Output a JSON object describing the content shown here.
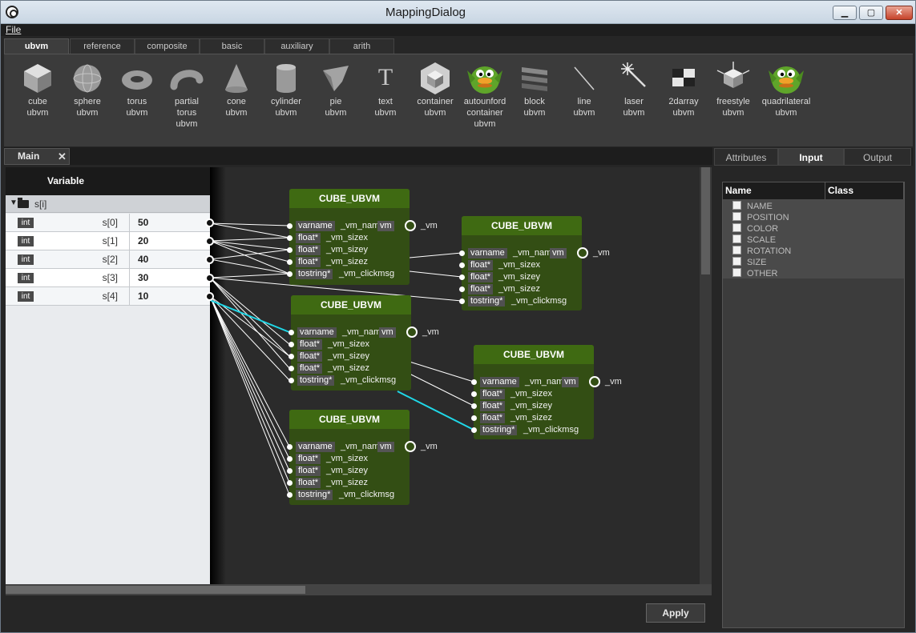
{
  "window": {
    "title": "MappingDialog"
  },
  "menu": {
    "file": "File"
  },
  "category_tabs": [
    "ubvm",
    "reference",
    "composite",
    "basic",
    "auxiliary",
    "arith"
  ],
  "palette": [
    {
      "label": "cube\nubvm",
      "icon": "cube-icon"
    },
    {
      "label": "sphere\nubvm",
      "icon": "sphere-icon"
    },
    {
      "label": "torus\nubvm",
      "icon": "torus-icon"
    },
    {
      "label": "partial\ntorus\nubvm",
      "icon": "partial-torus-icon"
    },
    {
      "label": "cone\nubvm",
      "icon": "cone-icon"
    },
    {
      "label": "cylinder\nubvm",
      "icon": "cylinder-icon"
    },
    {
      "label": "pie\nubvm",
      "icon": "pie-icon"
    },
    {
      "label": "text\nubvm",
      "icon": "text-icon"
    },
    {
      "label": "container\nubvm",
      "icon": "container-icon"
    },
    {
      "label": "autounford\ncontainer\nubvm",
      "icon": "duck-mascot-icon"
    },
    {
      "label": "block\nubvm",
      "icon": "block-icon"
    },
    {
      "label": "line\nubvm",
      "icon": "line-icon"
    },
    {
      "label": "laser\nubvm",
      "icon": "laser-icon"
    },
    {
      "label": "2darray\nubvm",
      "icon": "grid-2darray-icon"
    },
    {
      "label": "freestyle\nubvm",
      "icon": "freestyle-icon"
    },
    {
      "label": "quadrilateral\nubvm",
      "icon": "duck-mascot-icon"
    }
  ],
  "main_tab": {
    "label": "Main",
    "close": "✕"
  },
  "variables": {
    "header": "Variable",
    "group": "s[i]",
    "rows": [
      {
        "type": "int",
        "name": "s[0]",
        "value": "50"
      },
      {
        "type": "int",
        "name": "s[1]",
        "value": "20"
      },
      {
        "type": "int",
        "name": "s[2]",
        "value": "40"
      },
      {
        "type": "int",
        "name": "s[3]",
        "value": "30"
      },
      {
        "type": "int",
        "name": "s[4]",
        "value": "10"
      }
    ]
  },
  "node_common": {
    "title": "CUBE_UBVM",
    "vm_tag": "vm",
    "output_label": "_vm",
    "ports": [
      {
        "type": "varname",
        "name": "_vm_nam"
      },
      {
        "type": "float*",
        "name": "_vm_sizex"
      },
      {
        "type": "float*",
        "name": "_vm_sizey"
      },
      {
        "type": "float*",
        "name": "_vm_sizez"
      },
      {
        "type": "tostring*",
        "name": "_vm_clickmsg"
      }
    ]
  },
  "apply_button": "Apply",
  "right_tabs": [
    "Attributes",
    "Input",
    "Output"
  ],
  "properties": {
    "col_name": "Name",
    "col_class": "Class",
    "items": [
      "NAME",
      "POSITION",
      "COLOR",
      "SCALE",
      "ROTATION",
      "SIZE",
      "OTHER"
    ]
  },
  "colors": {
    "node_bg": "#334e14",
    "node_title": "#3f6a12",
    "highlight_wire": "#1fd8e8"
  }
}
